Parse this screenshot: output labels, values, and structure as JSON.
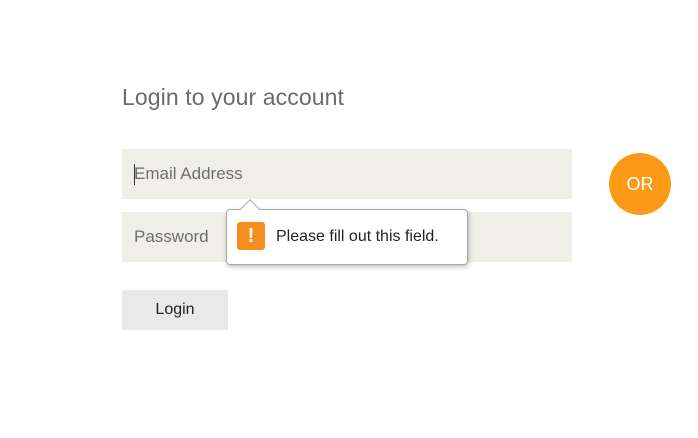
{
  "form": {
    "heading": "Login to your account",
    "email_placeholder": "Email Address",
    "email_value": "",
    "password_placeholder": "Password",
    "password_value": "",
    "login_label": "Login"
  },
  "divider": {
    "or_label": "OR",
    "color": "#fb9a16"
  },
  "validation_tooltip": {
    "icon": "warning-icon",
    "icon_glyph": "!",
    "message": "Please fill out this field."
  },
  "colors": {
    "field_background": "#efeee7",
    "warning": "#f58e1d"
  }
}
